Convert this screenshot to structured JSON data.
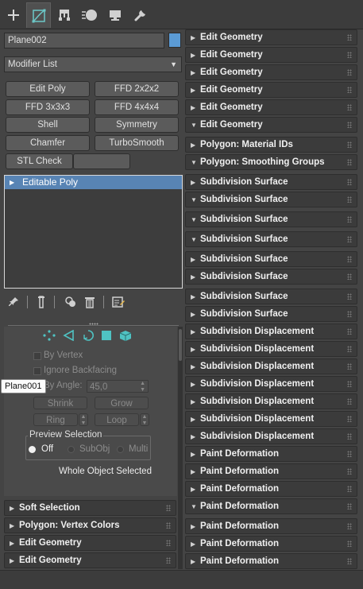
{
  "tabs": [
    {
      "icon": "plus-icon",
      "name": "tab-create"
    },
    {
      "icon": "modify-icon",
      "name": "tab-modify"
    },
    {
      "icon": "hierarchy-icon",
      "name": "tab-hierarchy"
    },
    {
      "icon": "motion-icon",
      "name": "tab-motion"
    },
    {
      "icon": "display-icon",
      "name": "tab-display"
    },
    {
      "icon": "utilities-icon",
      "name": "tab-utilities"
    }
  ],
  "object": {
    "name": "Plane002",
    "color": "#5b9bd5"
  },
  "modifier_list": {
    "value": "Modifier List"
  },
  "quick_buttons": [
    "Edit Poly",
    "FFD 2x2x2",
    "FFD 3x3x3",
    "FFD 4x4x4",
    "Shell",
    "Symmetry",
    "Chamfer",
    "TurboSmooth",
    "STL Check",
    ""
  ],
  "stack": {
    "items": [
      "Editable Poly"
    ]
  },
  "selection": {
    "by_vertex": "By Vertex",
    "ignore_backfacing": "Ignore Backfacing",
    "by_angle": "By Angle:",
    "angle_value": "45,0",
    "shrink": "Shrink",
    "grow": "Grow",
    "ring": "Ring",
    "loop": "Loop",
    "preview_label": "Preview Selection",
    "preview_options": [
      "Off",
      "SubObj",
      "Multi"
    ],
    "status": "Whole Object Selected"
  },
  "tooltip": "Plane001",
  "left_rollouts": [
    "Soft Selection",
    "Polygon: Vertex Colors",
    "Edit Geometry",
    "Edit Geometry"
  ],
  "right_rollouts": [
    {
      "label": "Edit Geometry",
      "open": false
    },
    {
      "label": "Edit Geometry",
      "open": false
    },
    {
      "label": "Edit Geometry",
      "open": false
    },
    {
      "label": "Edit Geometry",
      "open": false
    },
    {
      "label": "Edit Geometry",
      "open": false
    },
    {
      "label": "Edit Geometry",
      "open": true
    },
    {
      "label": "Polygon: Material IDs",
      "open": false
    },
    {
      "label": "Polygon: Smoothing Groups",
      "open": true
    },
    {
      "label": "Subdivision Surface",
      "open": false
    },
    {
      "label": "Subdivision Surface",
      "open": true
    },
    {
      "label": "Subdivision Surface",
      "open": true
    },
    {
      "label": "Subdivision Surface",
      "open": true
    },
    {
      "label": "Subdivision Surface",
      "open": false
    },
    {
      "label": "Subdivision Surface",
      "open": false
    },
    {
      "label": "Subdivision Surface",
      "open": false
    },
    {
      "label": "Subdivision Surface",
      "open": false
    },
    {
      "label": "Subdivision Displacement",
      "open": false
    },
    {
      "label": "Subdivision Displacement",
      "open": false
    },
    {
      "label": "Subdivision Displacement",
      "open": false
    },
    {
      "label": "Subdivision Displacement",
      "open": false
    },
    {
      "label": "Subdivision Displacement",
      "open": false
    },
    {
      "label": "Subdivision Displacement",
      "open": false
    },
    {
      "label": "Subdivision Displacement",
      "open": false
    },
    {
      "label": "Paint Deformation",
      "open": false
    },
    {
      "label": "Paint Deformation",
      "open": false
    },
    {
      "label": "Paint Deformation",
      "open": false
    },
    {
      "label": "Paint Deformation",
      "open": true
    },
    {
      "label": "Paint Deformation",
      "open": false
    },
    {
      "label": "Paint Deformation",
      "open": false
    },
    {
      "label": "Paint Deformation",
      "open": false
    }
  ]
}
